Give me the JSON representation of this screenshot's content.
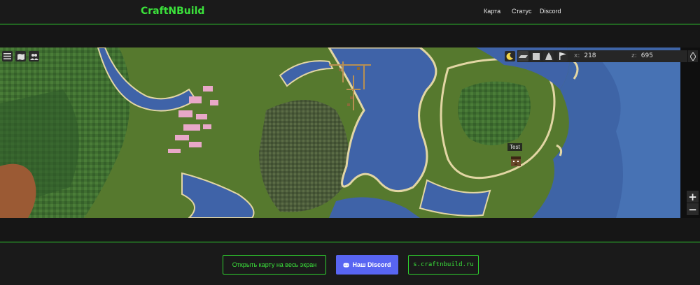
{
  "header": {
    "logo": "CraftNBuild",
    "nav": [
      {
        "label": "Карта"
      },
      {
        "label": "Статус"
      },
      {
        "label": "Discord"
      }
    ]
  },
  "map": {
    "coords": {
      "x_label": "x:",
      "x_value": "218",
      "z_label": "z:",
      "z_value": "695"
    },
    "player_name": "Test",
    "zoom_in": "+",
    "zoom_out": "−"
  },
  "footer": {
    "fullscreen_label": "Открыть карту на весь экран",
    "discord_label": "Наш Discord",
    "address_label": "s.craftnbuild.ru"
  },
  "colors": {
    "accent": "#2fd12f",
    "discord": "#5865f2",
    "background": "#1c1c1c"
  },
  "icons": [
    "menu-icon",
    "map-icon",
    "players-icon",
    "moon-icon",
    "flat-view-icon",
    "square-view-icon",
    "free-view-icon",
    "flag-icon",
    "discord-icon"
  ]
}
